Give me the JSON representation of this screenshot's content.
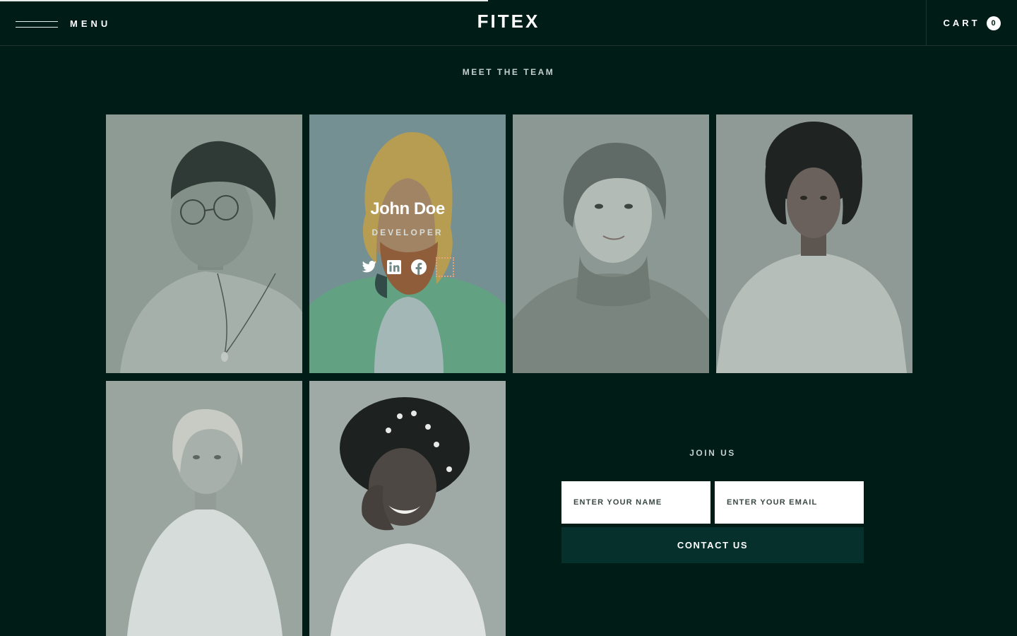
{
  "colors": {
    "background": "#001c17",
    "accent_button": "#05302c",
    "text": "#ffffff"
  },
  "scroll_progress": 0.48,
  "header": {
    "menu_label": "MENU",
    "logo": "FITEX",
    "cart_label": "CART",
    "cart_count": "0"
  },
  "team": {
    "title": "MEET THE TEAM",
    "hovered_member": {
      "name": "John Doe",
      "role": "DEVELOPER"
    },
    "social_icons": [
      "twitter-icon",
      "linkedin-icon",
      "facebook-icon",
      "instagram-icon"
    ]
  },
  "join": {
    "title": "JOIN US",
    "name_placeholder": "ENTER YOUR NAME",
    "email_placeholder": "ENTER YOUR EMAIL",
    "button_label": "CONTACT US"
  }
}
